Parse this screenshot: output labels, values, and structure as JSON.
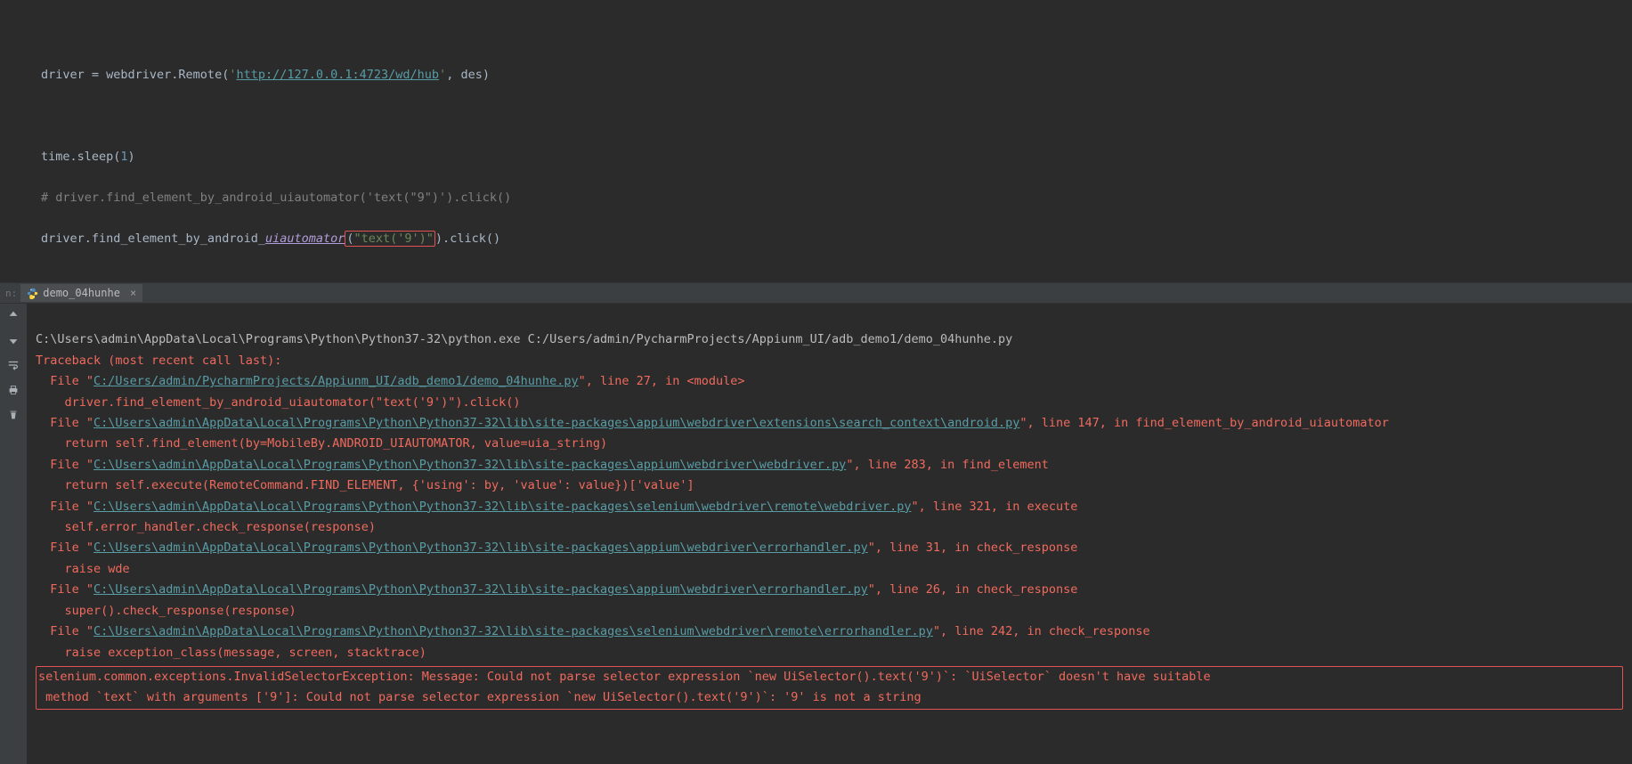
{
  "editor": {
    "line1_pre": "driver = webdriver.Remote(",
    "line1_q1": "'",
    "line1_url": "http://127.0.0.1:4723/wd/hub",
    "line1_q2": "'",
    "line1_post": ", des)",
    "line2_pre": "time.sleep(",
    "line2_num": "1",
    "line2_post": ")",
    "line3_comment": "# driver.find_element_by_android_uiautomator('text(\"9\")').click()",
    "line4_pre": "driver.find_element_by_android_",
    "line4_func": "uiautomator",
    "line4_paren_open": "(",
    "line4_arg": "\"text('9')\"",
    "line4_paren_close": ").",
    "line4_click": "click()"
  },
  "output": {
    "tab_label": "demo_04hunhe",
    "cmd": "C:\\Users\\admin\\AppData\\Local\\Programs\\Python\\Python37-32\\python.exe C:/Users/admin/PycharmProjects/Appiunm_UI/adb_demo1/demo_04hunhe.py",
    "traceback_header": "Traceback (most recent call last):",
    "frame1_pre": "  File \"",
    "frame1_link": "C:/Users/admin/PycharmProjects/Appiunm_UI/adb_demo1/demo_04hunhe.py",
    "frame1_post": "\", line 27, in <module>",
    "frame1_code": "    driver.find_element_by_android_uiautomator(\"text('9')\").click()",
    "frame2_pre": "  File \"",
    "frame2_link": "C:\\Users\\admin\\AppData\\Local\\Programs\\Python\\Python37-32\\lib\\site-packages\\appium\\webdriver\\extensions\\search_context\\android.py",
    "frame2_post": "\", line 147, in find_element_by_android_uiautomator",
    "frame2_code": "    return self.find_element(by=MobileBy.ANDROID_UIAUTOMATOR, value=uia_string)",
    "frame3_pre": "  File \"",
    "frame3_link": "C:\\Users\\admin\\AppData\\Local\\Programs\\Python\\Python37-32\\lib\\site-packages\\appium\\webdriver\\webdriver.py",
    "frame3_post": "\", line 283, in find_element",
    "frame3_code": "    return self.execute(RemoteCommand.FIND_ELEMENT, {'using': by, 'value': value})['value']",
    "frame4_pre": "  File \"",
    "frame4_link": "C:\\Users\\admin\\AppData\\Local\\Programs\\Python\\Python37-32\\lib\\site-packages\\selenium\\webdriver\\remote\\webdriver.py",
    "frame4_post": "\", line 321, in execute",
    "frame4_code": "    self.error_handler.check_response(response)",
    "frame5_pre": "  File \"",
    "frame5_link": "C:\\Users\\admin\\AppData\\Local\\Programs\\Python\\Python37-32\\lib\\site-packages\\appium\\webdriver\\errorhandler.py",
    "frame5_post": "\", line 31, in check_response",
    "frame5_code": "    raise wde",
    "frame6_pre": "  File \"",
    "frame6_link": "C:\\Users\\admin\\AppData\\Local\\Programs\\Python\\Python37-32\\lib\\site-packages\\appium\\webdriver\\errorhandler.py",
    "frame6_post": "\", line 26, in check_response",
    "frame6_code": "    super().check_response(response)",
    "frame7_pre": "  File \"",
    "frame7_link": "C:\\Users\\admin\\AppData\\Local\\Programs\\Python\\Python37-32\\lib\\site-packages\\selenium\\webdriver\\remote\\errorhandler.py",
    "frame7_post": "\", line 242, in check_response",
    "frame7_code": "    raise exception_class(message, screen, stacktrace)",
    "exception_line1": "selenium.common.exceptions.InvalidSelectorException: Message: Could not parse selector expression `new UiSelector().text('9')`: `UiSelector` doesn't have suitable",
    "exception_line2": " method `text` with arguments ['9']: Could not parse selector expression `new UiSelector().text('9')`: '9' is not a string"
  },
  "side_label": "n:"
}
